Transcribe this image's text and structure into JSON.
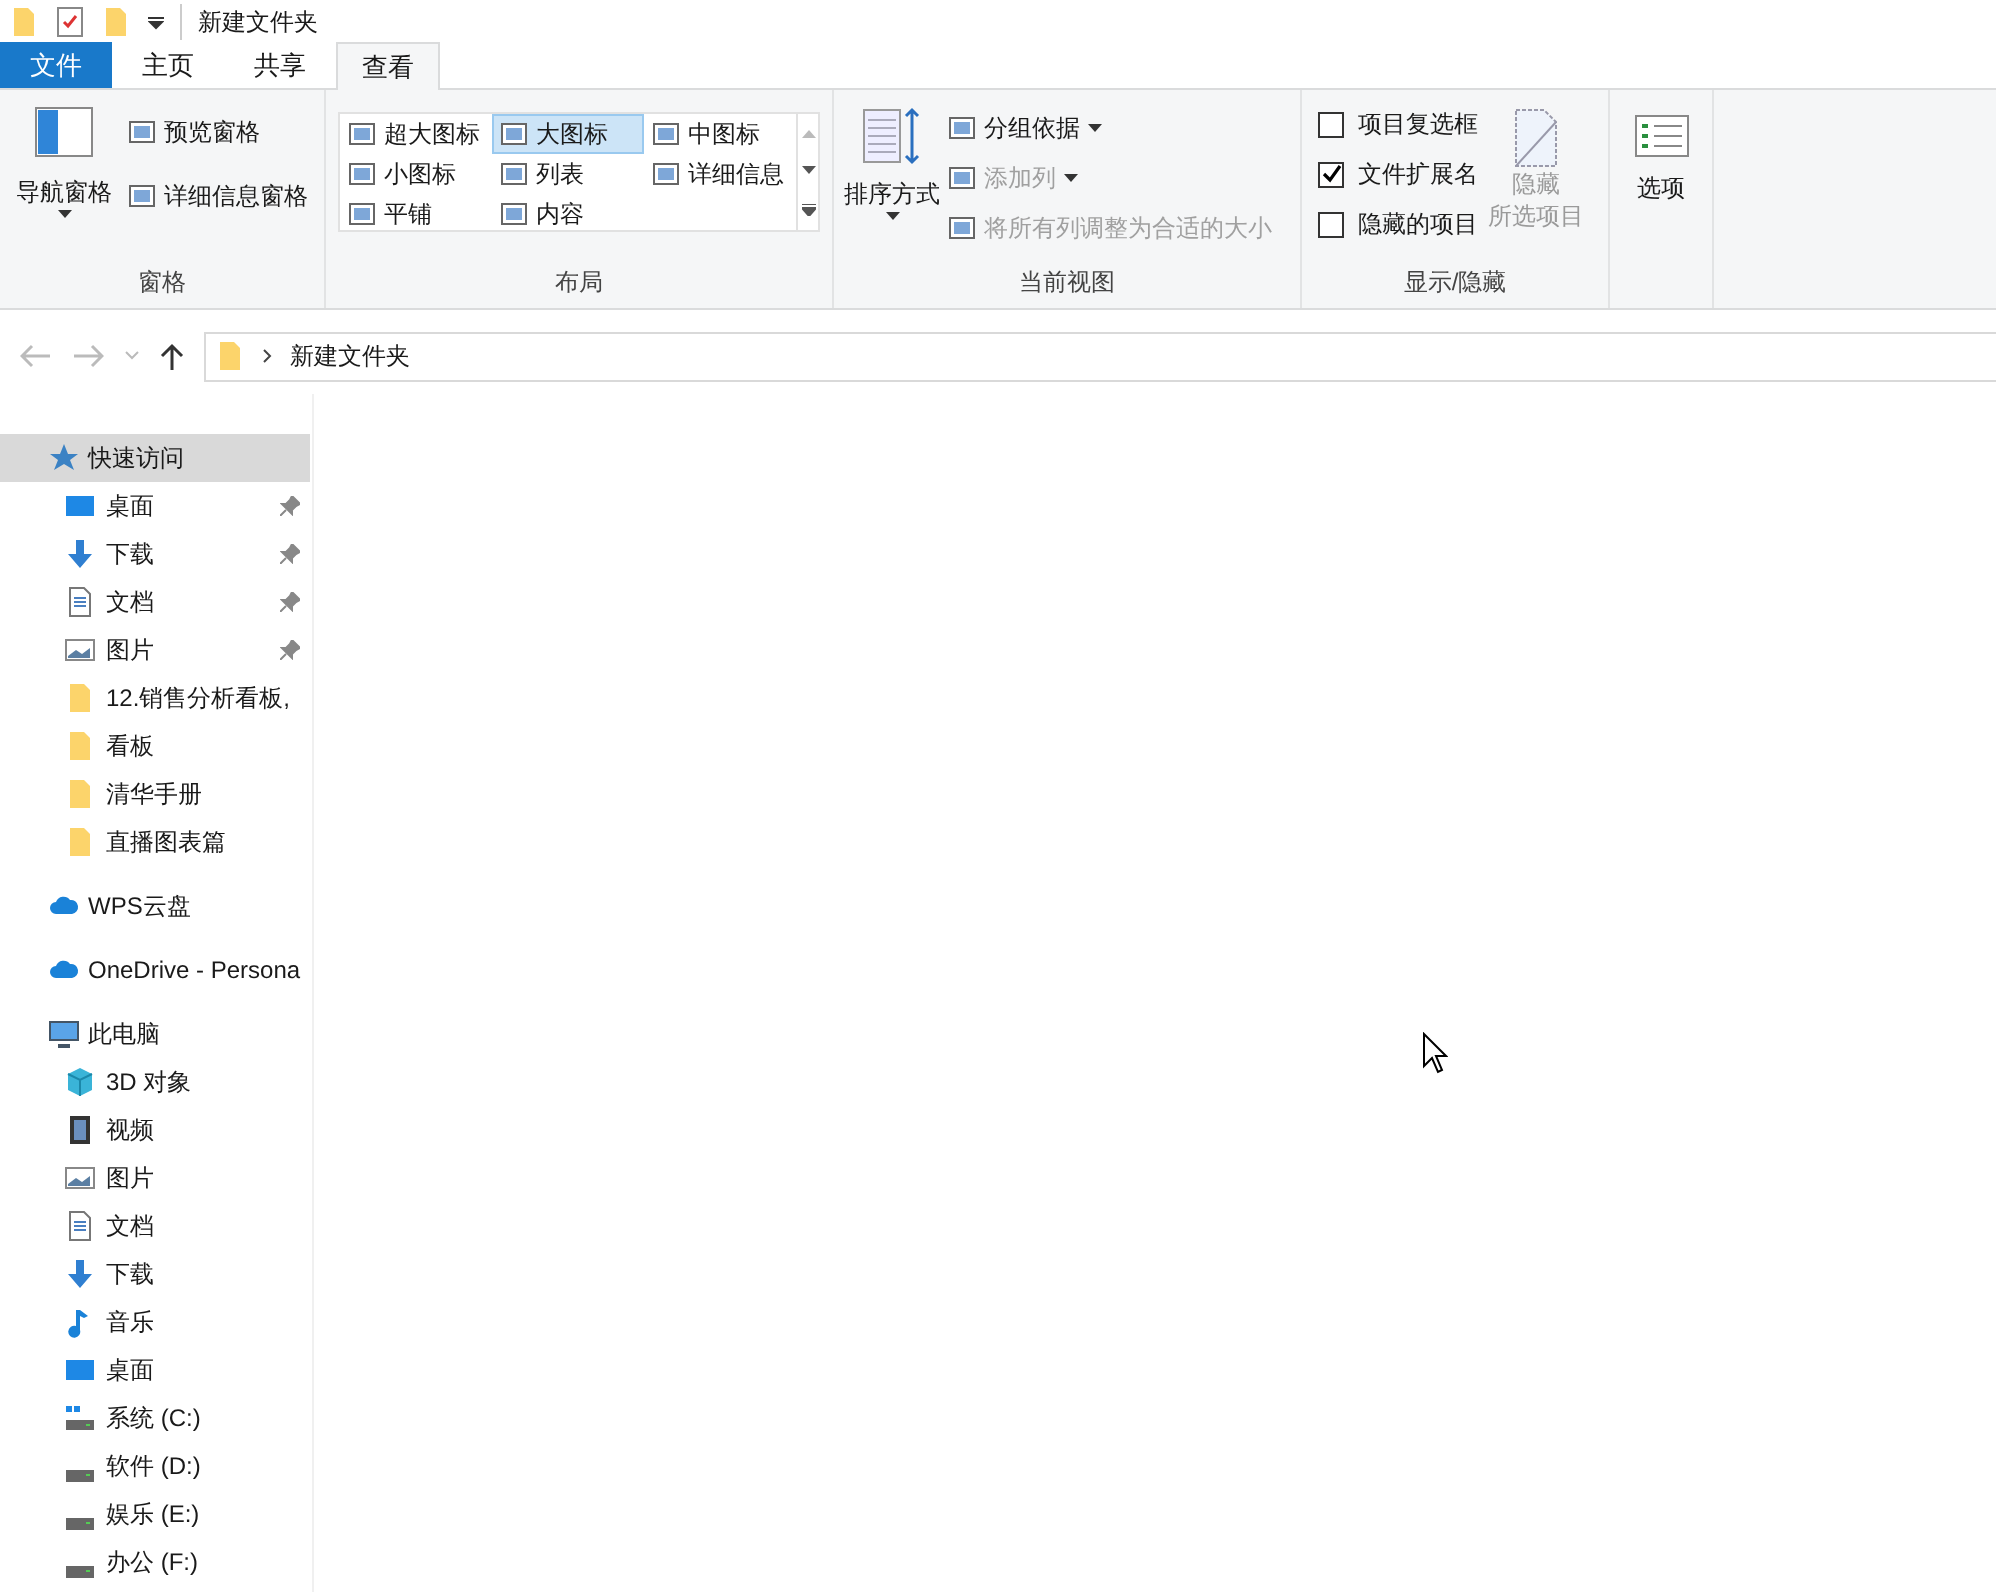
{
  "title_bar": {
    "title": "新建文件夹"
  },
  "ribbon_tabs": [
    {
      "label": "文件",
      "kind": "file",
      "selected": false
    },
    {
      "label": "主页",
      "kind": "tab",
      "selected": false
    },
    {
      "label": "共享",
      "kind": "tab",
      "selected": false
    },
    {
      "label": "查看",
      "kind": "tab",
      "selected": true
    }
  ],
  "ribbon": {
    "panes": {
      "label": "窗格",
      "nav_pane": "导航窗格",
      "preview_pane": "预览窗格",
      "details_pane": "详细信息窗格"
    },
    "layout": {
      "label": "布局",
      "options": [
        {
          "label": "超大图标",
          "selected": false
        },
        {
          "label": "大图标",
          "selected": true
        },
        {
          "label": "中图标",
          "selected": false
        },
        {
          "label": "小图标",
          "selected": false
        },
        {
          "label": "列表",
          "selected": false
        },
        {
          "label": "详细信息",
          "selected": false
        },
        {
          "label": "平铺",
          "selected": false
        },
        {
          "label": "内容",
          "selected": false
        }
      ]
    },
    "current_view": {
      "label": "当前视图",
      "sort_by": "排序方式",
      "commands": [
        {
          "label": "分组依据",
          "disabled": false
        },
        {
          "label": "添加列",
          "disabled": true
        },
        {
          "label": "将所有列调整为合适的大小",
          "disabled": true
        }
      ]
    },
    "show_hide": {
      "label": "显示/隐藏",
      "checkboxes": [
        {
          "label": "项目复选框",
          "checked": false
        },
        {
          "label": "文件扩展名",
          "checked": true
        },
        {
          "label": "隐藏的项目",
          "checked": false
        }
      ],
      "hide_selected": {
        "lines": [
          "隐藏",
          "所选项目"
        ],
        "disabled": true
      }
    },
    "options": {
      "label": "选项"
    }
  },
  "address_bar": {
    "path": [
      {
        "label": "新建文件夹"
      }
    ]
  },
  "nav_pane": {
    "items": [
      {
        "label": "快速访问",
        "kind": "star",
        "selected": true,
        "children": [
          {
            "label": "桌面",
            "kind": "desktop",
            "pinned": true
          },
          {
            "label": "下载",
            "kind": "download",
            "pinned": true
          },
          {
            "label": "文档",
            "kind": "document",
            "pinned": true
          },
          {
            "label": "图片",
            "kind": "picture",
            "pinned": true
          },
          {
            "label": "12.销售分析看板,",
            "kind": "folder",
            "pinned": false
          },
          {
            "label": "看板",
            "kind": "folder",
            "pinned": false
          },
          {
            "label": "清华手册",
            "kind": "folder",
            "pinned": false
          },
          {
            "label": "直播图表篇",
            "kind": "folder",
            "pinned": false
          }
        ]
      },
      {
        "label": "WPS云盘",
        "kind": "cloud",
        "selected": false
      },
      {
        "label": "OneDrive - Persona",
        "kind": "cloud",
        "selected": false
      },
      {
        "label": "此电脑",
        "kind": "pc",
        "selected": false,
        "children": [
          {
            "label": "3D 对象",
            "kind": "cube",
            "pinned": false
          },
          {
            "label": "视频",
            "kind": "video",
            "pinned": false
          },
          {
            "label": "图片",
            "kind": "picture",
            "pinned": false
          },
          {
            "label": "文档",
            "kind": "document",
            "pinned": false
          },
          {
            "label": "下载",
            "kind": "download",
            "pinned": false
          },
          {
            "label": "音乐",
            "kind": "music",
            "pinned": false
          },
          {
            "label": "桌面",
            "kind": "desktop",
            "pinned": false
          },
          {
            "label": "系统 (C:)",
            "kind": "system_drive",
            "pinned": false
          },
          {
            "label": "软件 (D:)",
            "kind": "drive",
            "pinned": false
          },
          {
            "label": "娱乐 (E:)",
            "kind": "drive",
            "pinned": false
          },
          {
            "label": "办公 (F:)",
            "kind": "drive",
            "pinned": false
          }
        ]
      }
    ]
  }
}
